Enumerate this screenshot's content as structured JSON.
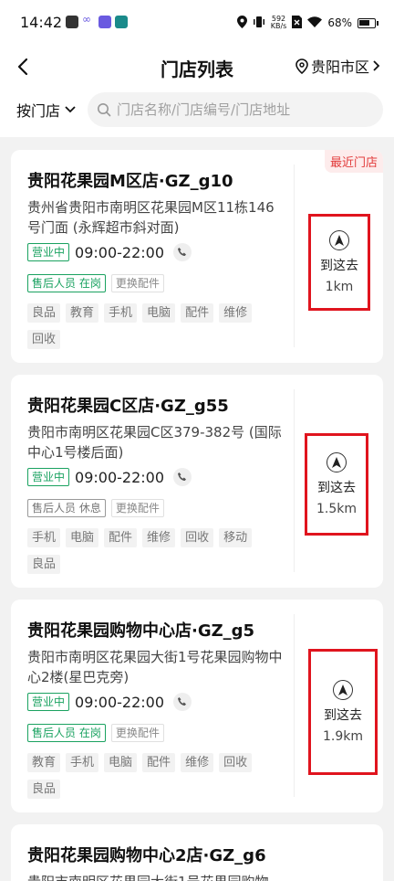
{
  "status_bar": {
    "time": "14:42",
    "net_speed_value": "592",
    "net_speed_unit": "KB/s",
    "battery": "68%"
  },
  "header": {
    "title": "门店列表",
    "city": "贵阳市区"
  },
  "filter": {
    "label": "按门店",
    "search_placeholder": "门店名称/门店编号/门店地址"
  },
  "stores": [
    {
      "name": "贵阳花果园M区店·GZ_g10",
      "address": "贵州省贵阳市南明区花果园M区11栋146号门面 (永辉超市斜对面)",
      "status": "营业中",
      "hours": "09:00-22:00",
      "staff": "售后人员 在岗",
      "staff_on": true,
      "parts": "更换配件",
      "tags": [
        "良品",
        "教育",
        "手机",
        "电脑",
        "配件",
        "维修",
        "回收"
      ],
      "recent_label": "最近门店",
      "go_label": "到这去",
      "distance": "1km"
    },
    {
      "name": "贵阳花果园C区店·GZ_g55",
      "address": "贵阳市南明区花果园C区379-382号 (国际中心1号楼后面)",
      "status": "营业中",
      "hours": "09:00-22:00",
      "staff": "售后人员 休息",
      "staff_on": false,
      "parts": "更换配件",
      "tags": [
        "手机",
        "电脑",
        "配件",
        "维修",
        "回收",
        "移动",
        "良品"
      ],
      "go_label": "到这去",
      "distance": "1.5km"
    },
    {
      "name": "贵阳花果园购物中心店·GZ_g5",
      "address": "贵阳市南明区花果园大街1号花果园购物中心2楼(星巴克旁)",
      "status": "营业中",
      "hours": "09:00-22:00",
      "staff": "售后人员 在岗",
      "staff_on": true,
      "parts": "更换配件",
      "tags": [
        "教育",
        "手机",
        "电脑",
        "配件",
        "维修",
        "回收",
        "良品"
      ],
      "go_label": "到这去",
      "distance": "1.9km"
    },
    {
      "name": "贵阳花果园购物中心2店·GZ_g6",
      "address": "贵阳市南明区花果园大街1号花果园购物"
    }
  ],
  "colors": {
    "accent_green": "#1aa260",
    "highlight_red": "#e0141e",
    "recent_red": "#e23b3b"
  }
}
